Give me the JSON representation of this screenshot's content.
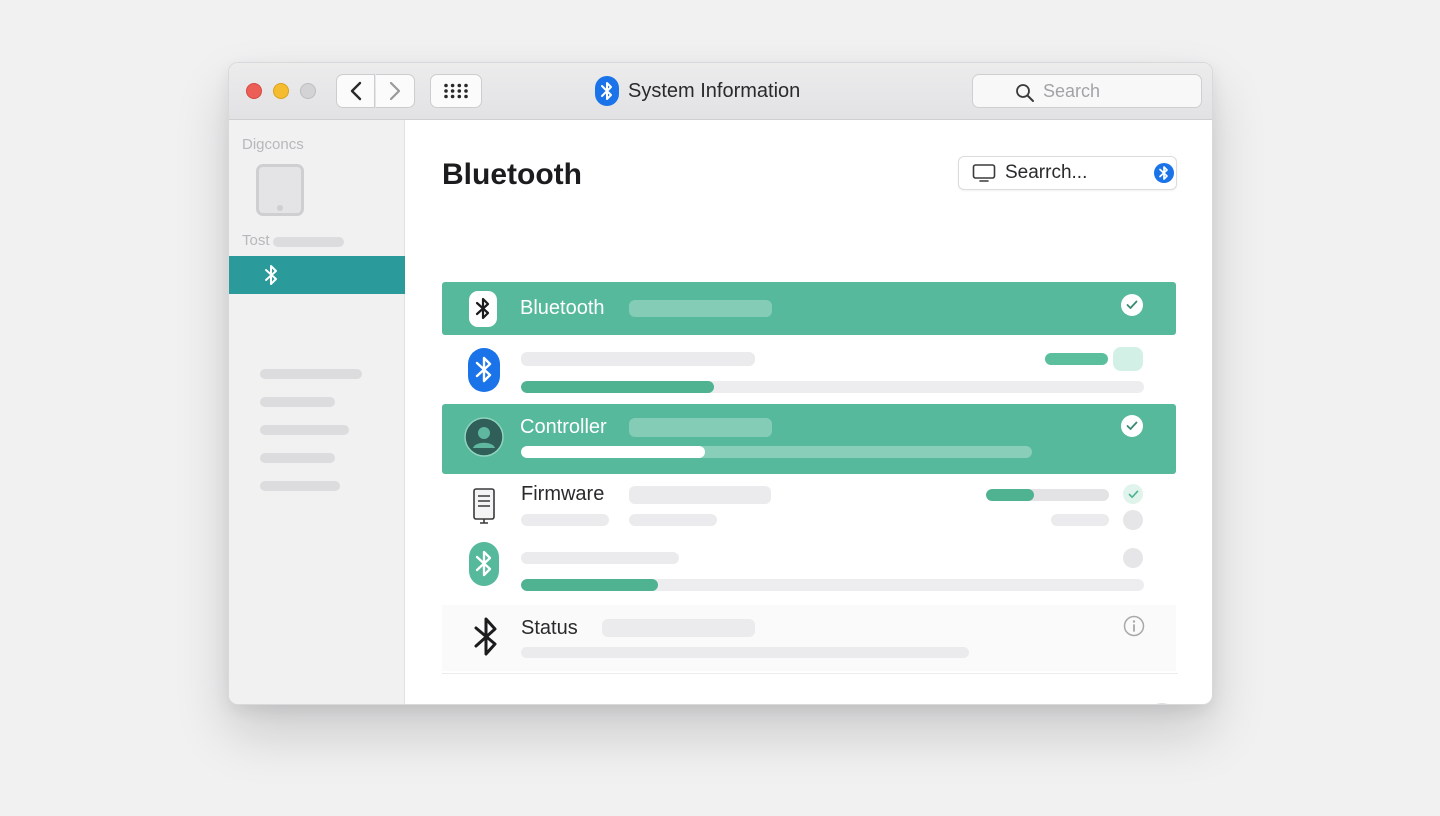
{
  "window": {
    "title": "System Information",
    "search_placeholder": "Search"
  },
  "sidebar": {
    "group1_label": "Digconcs",
    "group2_label": "Tost"
  },
  "main": {
    "heading": "Bluetooth",
    "search_label": "Searrch...",
    "rows": [
      {
        "label": "Bluetooth",
        "checked": true
      },
      {
        "label": "",
        "progress": 0.31
      },
      {
        "label": "Controller",
        "checked": true,
        "progress": 0.36
      },
      {
        "label": "Firmware",
        "progress": 0.39,
        "checked": true
      },
      {
        "label": "",
        "progress": 0.22
      },
      {
        "label": "Status"
      }
    ],
    "help_label": "?"
  },
  "colors": {
    "accent_green": "#56b99b",
    "sidebar_selected": "#2a9a9b",
    "bluetooth_blue": "#1a73e8"
  },
  "icons": [
    "bluetooth-icon",
    "search-icon",
    "chevron-left-icon",
    "chevron-right-icon",
    "grid-icon",
    "check-icon",
    "info-icon",
    "help-icon",
    "display-icon",
    "controller-icon",
    "firmware-icon",
    "tablet-icon"
  ]
}
